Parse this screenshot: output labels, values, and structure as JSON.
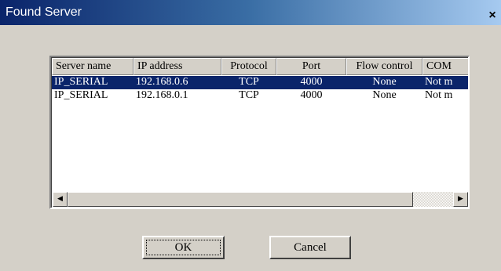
{
  "window": {
    "title": "Found Server",
    "close_glyph": "×"
  },
  "list": {
    "columns": [
      "Server name",
      "IP address",
      "Protocol",
      "Port",
      "Flow control",
      "COM"
    ],
    "rows": [
      {
        "server_name": "IP_SERIAL",
        "ip": "192.168.0.6",
        "protocol": "TCP",
        "port": "4000",
        "flow": "None",
        "com": "Not m",
        "selected": true
      },
      {
        "server_name": "IP_SERIAL",
        "ip": "192.168.0.1",
        "protocol": "TCP",
        "port": "4000",
        "flow": "None",
        "com": "Not m",
        "selected": false
      }
    ]
  },
  "scrollbar": {
    "left_arrow": "◀",
    "right_arrow": "▶"
  },
  "buttons": {
    "ok": "OK",
    "cancel": "Cancel"
  },
  "colors": {
    "selection": "#0a246a",
    "title_start": "#0a246a",
    "title_end": "#a6caf0",
    "face": "#d4d0c8"
  }
}
